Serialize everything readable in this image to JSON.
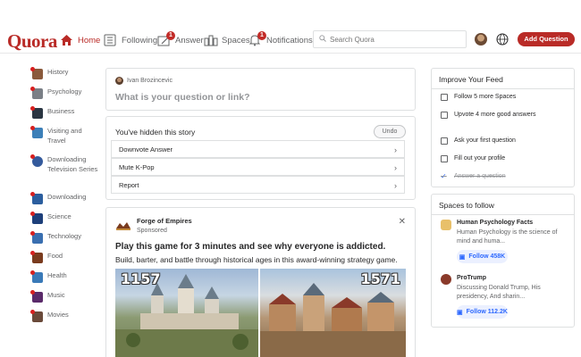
{
  "header": {
    "logo": "Quora",
    "nav": [
      {
        "label": "Home",
        "icon": "home-icon",
        "active": true
      },
      {
        "label": "Following",
        "icon": "following-icon",
        "active": false
      },
      {
        "label": "Answer",
        "icon": "answer-icon",
        "active": false,
        "badge": "1"
      },
      {
        "label": "Spaces",
        "icon": "spaces-icon",
        "active": false
      },
      {
        "label": "Notifications",
        "icon": "bell-icon",
        "active": false,
        "badge": "1"
      }
    ],
    "search_placeholder": "Search Quora",
    "ask_button": "Add Question",
    "accent": "#b92b27"
  },
  "sidebar": {
    "items": [
      {
        "label": "History",
        "color": "#8a5a3c"
      },
      {
        "label": "Psychology",
        "color": "#7a7f86"
      },
      {
        "label": "Business",
        "color": "#2a3542"
      },
      {
        "label": "Visiting and Travel",
        "color": "#3c7fb8"
      },
      {
        "label": "Downloading Television Series",
        "color": "#345a9c"
      },
      {
        "label": "Downloading",
        "color": "#2b5e9e"
      },
      {
        "label": "Science",
        "color": "#1d3f7a"
      },
      {
        "label": "Technology",
        "color": "#3a6fb0"
      },
      {
        "label": "Food",
        "color": "#7a3b1e"
      },
      {
        "label": "Health",
        "color": "#3a7ab8"
      },
      {
        "label": "Music",
        "color": "#5a2a6a"
      },
      {
        "label": "Movies",
        "color": "#6a4a3a"
      }
    ]
  },
  "ask_box": {
    "user": "Ivan Brozincevic",
    "prompt": "What is your question or link?"
  },
  "hidden_story": {
    "title": "You've hidden this story",
    "undo": "Undo",
    "options": [
      "Downvote Answer",
      "Mute K-Pop",
      "Report"
    ]
  },
  "ad": {
    "name": "Forge of Empires",
    "sponsored": "Sponsored",
    "headline": "Play this game for 3 minutes and see why everyone is addicted.",
    "body": "Build, barter, and battle through historical ages in this award-winning strategy game.",
    "num_left": "1157",
    "num_right": "1571"
  },
  "improve_feed": {
    "title": "Improve Your Feed",
    "items": [
      {
        "label": "Follow 5 more Spaces",
        "done": false
      },
      {
        "label": "Upvote 4 more good answers",
        "done": false
      },
      {
        "label": "Ask your first question",
        "done": false
      },
      {
        "label": "Fill out your profile",
        "done": false
      },
      {
        "label": "Answer a question",
        "done": true
      }
    ]
  },
  "spaces_to_follow": {
    "title": "Spaces to follow",
    "items": [
      {
        "name": "Human Psychology Facts",
        "desc": "Human Psychology is the science of mind and huma...",
        "follow": "Follow 458K",
        "color": "#e8c06a"
      },
      {
        "name": "ProTrump",
        "desc": "Discussing Donald Trump, His presidency, And sharin...",
        "follow": "Follow 112.2K",
        "color": "#8a3a2a"
      }
    ]
  }
}
